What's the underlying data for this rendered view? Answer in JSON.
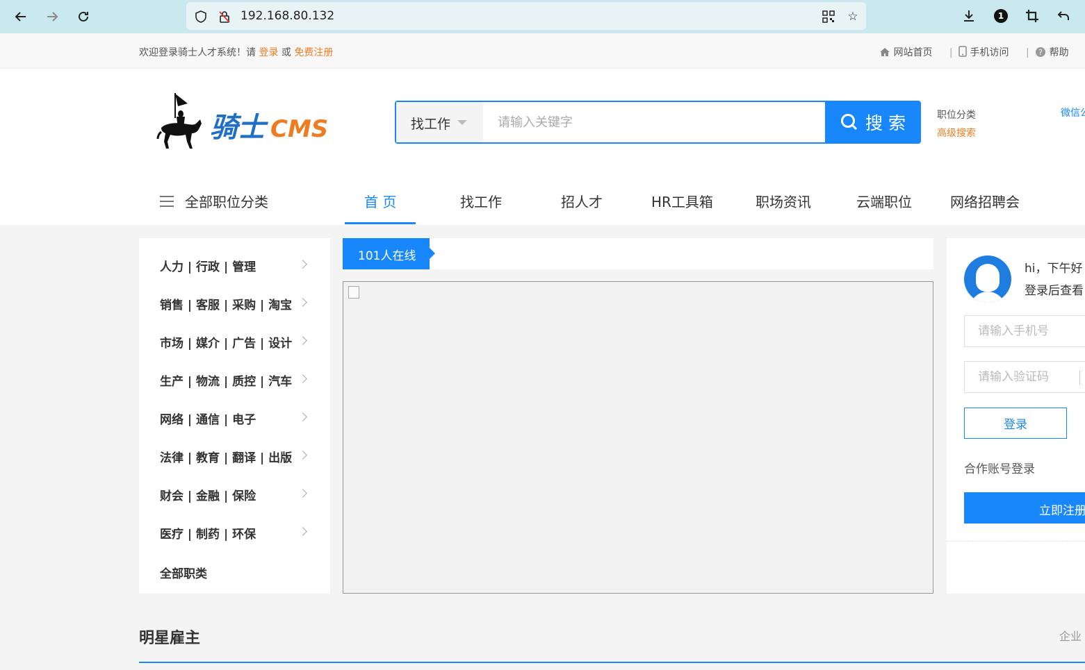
{
  "browser": {
    "url": "192.168.80.132",
    "notification_count": "1"
  },
  "topbar": {
    "welcome_text": "欢迎登录骑士人才系统！请",
    "login_link": "登录",
    "or_text": "或",
    "register_link": "免费注册",
    "links": [
      {
        "label": "网站首页",
        "icon": "home-icon"
      },
      {
        "label": "手机访问",
        "icon": "mobile-icon"
      },
      {
        "label": "帮助",
        "icon": "help-icon"
      }
    ]
  },
  "header": {
    "logo_text": "骑士CMS",
    "search": {
      "type_label": "找工作",
      "placeholder": "请输入关键字",
      "button_label": "搜 索"
    },
    "job_category_link": "职位分类",
    "advanced_search_link": "高级搜索",
    "weixin_label": "微信公"
  },
  "nav": {
    "all_categories": "全部职位分类",
    "items": [
      "首 页",
      "找工作",
      "招人才",
      "HR工具箱",
      "职场资讯",
      "云端职位",
      "网络招聘会"
    ],
    "active_index": 0
  },
  "categories": [
    "人力 | 行政 | 管理",
    "销售 | 客服 | 采购 | 淘宝",
    "市场 | 媒介 | 广告 | 设计",
    "生产 | 物流 | 质控 | 汽车",
    "网络 | 通信 | 电子",
    "法律 | 教育 | 翻译 | 出版",
    "财会 | 金融 | 保险",
    "医疗 | 制药 | 环保",
    "全部职类"
  ],
  "online": {
    "label": "101人在线"
  },
  "login_panel": {
    "greeting": "hi，下午好",
    "hint": "登录后查看",
    "phone_placeholder": "请输入手机号",
    "code_placeholder": "请输入验证码",
    "login_button": "登录",
    "partner_login": "合作账号登录",
    "register_button": "立即注册"
  },
  "sections": {
    "star_employers": "明星雇主",
    "company_link": "企业"
  },
  "colors": {
    "primary": "#1787fb",
    "accent_orange": "#f07c22",
    "browser_bar": "#c9e9ee"
  }
}
